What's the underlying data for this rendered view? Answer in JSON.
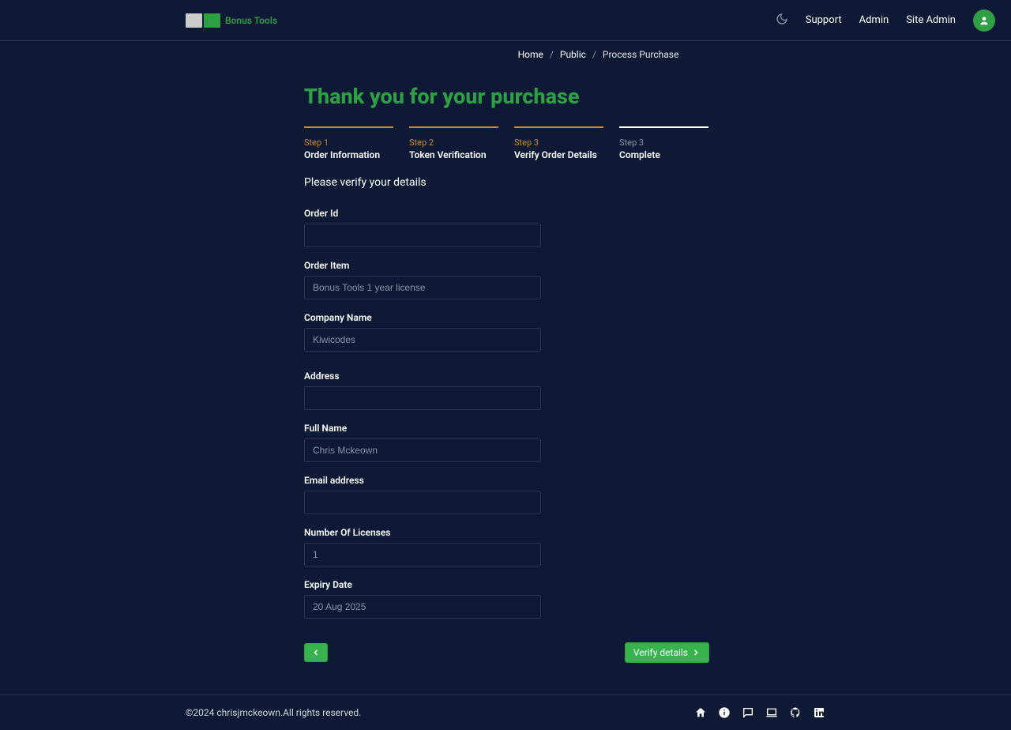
{
  "brand": {
    "name": "Bonus Tools"
  },
  "nav": {
    "support": "Support",
    "admin": "Admin",
    "siteAdmin": "Site Admin"
  },
  "breadcrumb": {
    "home": "Home",
    "public": "Public",
    "current": "Process Purchase"
  },
  "title": "Thank you for your purchase",
  "steps": [
    {
      "num": "Step 1",
      "label": "Order Information",
      "active": true
    },
    {
      "num": "Step 2",
      "label": "Token Verification",
      "active": true
    },
    {
      "num": "Step 3",
      "label": "Verify Order Details",
      "active": true
    },
    {
      "num": "Step 3",
      "label": "Complete",
      "active": false
    }
  ],
  "instruction": "Please verify your details",
  "form": {
    "orderId": {
      "label": "Order Id",
      "value": ""
    },
    "orderItem": {
      "label": "Order Item",
      "value": "Bonus Tools 1 year license"
    },
    "companyName": {
      "label": "Company Name",
      "value": "Kiwicodes"
    },
    "address": {
      "label": "Address",
      "value": ""
    },
    "fullName": {
      "label": "Full Name",
      "value": "Chris Mckeown"
    },
    "email": {
      "label": "Email address",
      "value": ""
    },
    "licenses": {
      "label": "Number Of Licenses",
      "value": "1"
    },
    "expiry": {
      "label": "Expiry Date",
      "value": "20 Aug 2025"
    }
  },
  "actions": {
    "verify": "Verify details"
  },
  "footer": {
    "copyright": "©2024 chrisjmckeown.All rights reserved."
  }
}
